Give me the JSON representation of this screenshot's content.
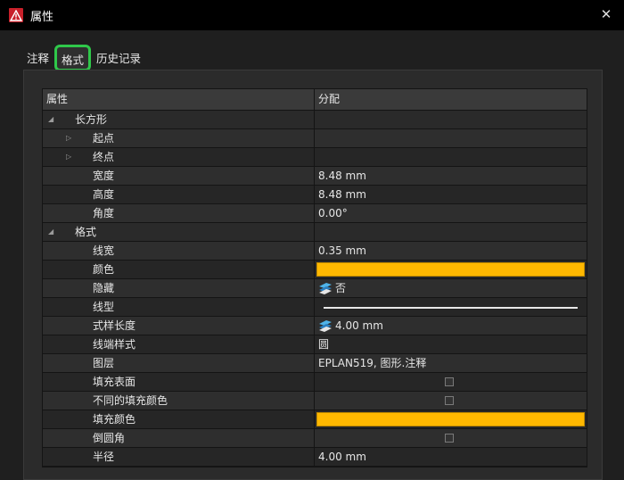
{
  "window": {
    "title": "属性"
  },
  "tabs": [
    {
      "label": "注释"
    },
    {
      "label": "格式"
    },
    {
      "label": "历史记录"
    }
  ],
  "grid": {
    "header": {
      "name": "属性",
      "value": "分配"
    },
    "rows": {
      "rect": {
        "name": "长方形"
      },
      "start": {
        "name": "起点"
      },
      "end": {
        "name": "终点"
      },
      "width": {
        "name": "宽度",
        "value": "8.48 mm"
      },
      "height": {
        "name": "高度",
        "value": "8.48 mm"
      },
      "angle": {
        "name": "角度",
        "value": "0.00°"
      },
      "format": {
        "name": "格式"
      },
      "linewidth": {
        "name": "线宽",
        "value": "0.35 mm"
      },
      "color": {
        "name": "颜色",
        "color": "#ffb800"
      },
      "hidden": {
        "name": "隐藏",
        "value": "否"
      },
      "linetype": {
        "name": "线型"
      },
      "patternlen": {
        "name": "式样长度",
        "value": "4.00 mm"
      },
      "lineend": {
        "name": "线端样式",
        "value": "圆"
      },
      "layer": {
        "name": "图层",
        "value": "EPLAN519, 图形.注释"
      },
      "fillsurface": {
        "name": "填充表面",
        "checked": false
      },
      "difffill": {
        "name": "不同的填充颜色",
        "checked": false
      },
      "fillcolor": {
        "name": "填充颜色",
        "color": "#ffb800"
      },
      "rounded": {
        "name": "倒圆角",
        "checked": false
      },
      "radius": {
        "name": "半径",
        "value": "4.00 mm"
      }
    }
  },
  "icons": {
    "app": "warning-triangle-icon",
    "close": "close-icon",
    "expanded": "triangle-down-icon",
    "collapsed": "triangle-right-icon",
    "param": "layered-parameter-icon"
  }
}
